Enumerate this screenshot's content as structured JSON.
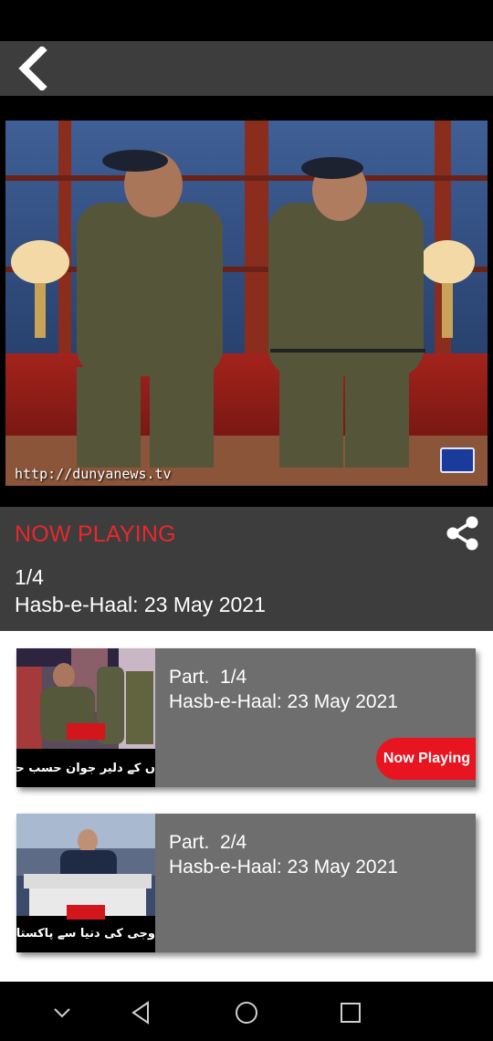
{
  "app_bar": {
    "back_icon": "chevron-left-icon"
  },
  "video": {
    "watermark": "http://dunyanews.tv",
    "channel_logo": "dunya-news-logo"
  },
  "now_playing": {
    "label": "NOW PLAYING",
    "part": "1/4",
    "title": "Hasb-e-Haal: 23 May 2021",
    "share_icon": "share-icon"
  },
  "playlist": [
    {
      "part": "Part.  1/4",
      "title": "Hasb-e-Haal: 23 May 2021",
      "badge": "Now Playing",
      "thumb_caption": "ں کے دلیر جوان حسب حال میں مہ"
    },
    {
      "part": "Part.  2/4",
      "title": "Hasb-e-Haal: 23 May 2021",
      "thumb_caption": "وجی کی دنیا سے پاکستان کیلئے بڑی خوش"
    }
  ],
  "nav": {
    "icons": [
      "chevron-down-icon",
      "back-triangle-icon",
      "home-circle-icon",
      "recents-square-icon"
    ]
  },
  "colors": {
    "accent": "#e8282b",
    "panel": "#3d3d3d",
    "card": "#6e6e6e"
  }
}
